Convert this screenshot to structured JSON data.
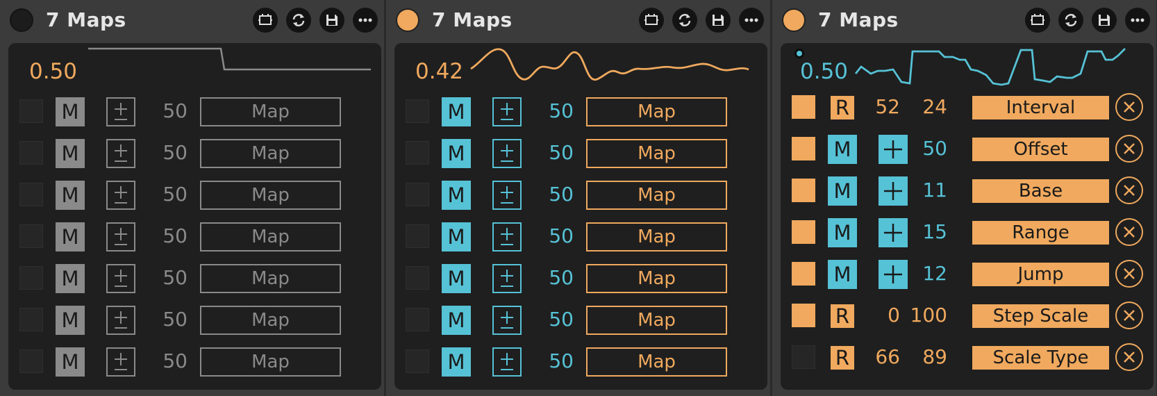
{
  "devices": [
    {
      "title": "7 Maps",
      "power_on": false,
      "value": "0.50",
      "wave_color": "#8a8a8a",
      "rows": [
        {
          "mode": "M",
          "value": "50",
          "map": "Map"
        },
        {
          "mode": "M",
          "value": "50",
          "map": "Map"
        },
        {
          "mode": "M",
          "value": "50",
          "map": "Map"
        },
        {
          "mode": "M",
          "value": "50",
          "map": "Map"
        },
        {
          "mode": "M",
          "value": "50",
          "map": "Map"
        },
        {
          "mode": "M",
          "value": "50",
          "map": "Map"
        },
        {
          "mode": "M",
          "value": "50",
          "map": "Map"
        }
      ]
    },
    {
      "title": "7 Maps",
      "power_on": true,
      "value": "0.42",
      "wave_color": "#f0a95e",
      "rows": [
        {
          "mode": "M",
          "value": "50",
          "map": "Map"
        },
        {
          "mode": "M",
          "value": "50",
          "map": "Map"
        },
        {
          "mode": "M",
          "value": "50",
          "map": "Map"
        },
        {
          "mode": "M",
          "value": "50",
          "map": "Map"
        },
        {
          "mode": "M",
          "value": "50",
          "map": "Map"
        },
        {
          "mode": "M",
          "value": "50",
          "map": "Map"
        },
        {
          "mode": "M",
          "value": "50",
          "map": "Map"
        }
      ]
    },
    {
      "title": "7 Maps",
      "power_on": true,
      "value": "0.50",
      "wave_color": "#56c2d6",
      "rows": [
        {
          "enabled": true,
          "mode": "R",
          "a": "52",
          "b": "24",
          "param": "Interval"
        },
        {
          "enabled": true,
          "mode": "M",
          "b": "50",
          "param": "Offset"
        },
        {
          "enabled": true,
          "mode": "M",
          "b": "11",
          "param": "Base"
        },
        {
          "enabled": true,
          "mode": "M",
          "b": "15",
          "param": "Range"
        },
        {
          "enabled": true,
          "mode": "M",
          "b": "12",
          "param": "Jump"
        },
        {
          "enabled": true,
          "mode": "R",
          "a": "0",
          "b": "100",
          "param": "Step Scale"
        },
        {
          "enabled": false,
          "mode": "R",
          "a": "66",
          "b": "89",
          "param": "Scale Type"
        }
      ]
    }
  ],
  "colors": {
    "accent": "#f0a95e",
    "blue": "#56c2d6",
    "inactive": "#8a8a8a"
  },
  "icons": [
    "power-icon",
    "hot-swap-icon",
    "refresh-icon",
    "save-icon",
    "more-icon",
    "plus-minus-icon",
    "plus-icon",
    "close-icon"
  ]
}
